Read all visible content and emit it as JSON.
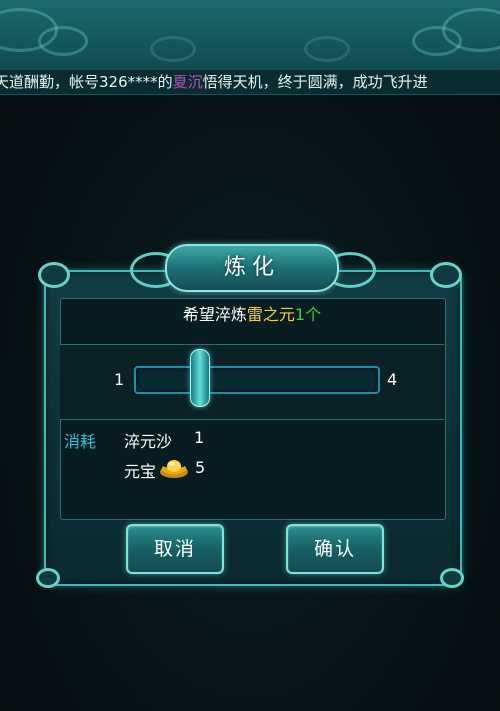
{
  "marquee": {
    "prefix": "天道酬勤，帐号326****的",
    "highlight": "夏沉",
    "suffix": "悟得天机，终于圆满，成功飞升进"
  },
  "dialog": {
    "title": "炼化",
    "hope": {
      "prefix": "希望淬炼",
      "item": "雷之元",
      "count": "1个"
    },
    "slider": {
      "min": "1",
      "max": "4",
      "value": 1
    },
    "cost": {
      "label": "消耗",
      "material_name": "淬元沙",
      "material_qty": "1",
      "currency_name": "元宝",
      "currency_icon": "gold-ingot-icon",
      "currency_qty": "5"
    },
    "buttons": {
      "cancel": "取消",
      "confirm": "确认"
    }
  },
  "colors": {
    "accent": "#3fb9b3",
    "gold": "#f2d13a",
    "green": "#39d33f",
    "cost_label": "#28c6d8"
  }
}
